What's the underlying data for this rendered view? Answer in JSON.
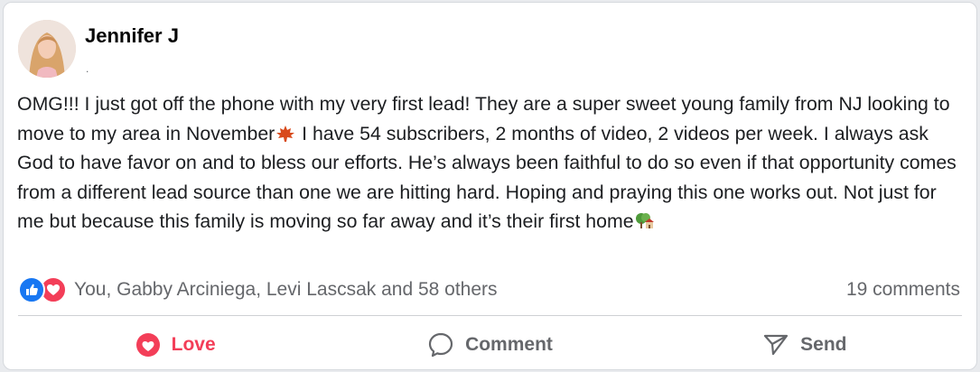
{
  "post": {
    "author": "Jennifer J",
    "meta": ".",
    "text_before_leaf": "OMG!!! I just got off the phone with my very first lead! They are a super sweet young family from NJ looking to move to my area in November",
    "text_middle": " I have 54 subscribers, 2 months of video, 2 videos per week. I always ask God to have favor on and to bless our efforts. He’s always been faithful to do so even if that opportunity comes from a different lead source than one we are hitting hard. Hoping and praying this one works out. Not just for me but because this family is moving so far away and it’s their first home",
    "inline_icons": [
      "maple-leaf-icon",
      "house-tree-icon"
    ]
  },
  "reactions": {
    "types": [
      "like-icon",
      "love-icon"
    ],
    "summary": "You, Gabby Arciniega, Levi Lascsak and 58 others",
    "comments": "19 comments"
  },
  "actions": {
    "love_label": "Love",
    "comment_label": "Comment",
    "send_label": "Send"
  },
  "colors": {
    "love": "#f33e58",
    "like": "#1877f2",
    "muted_text": "#65676b",
    "body_text": "#1c1e21"
  }
}
